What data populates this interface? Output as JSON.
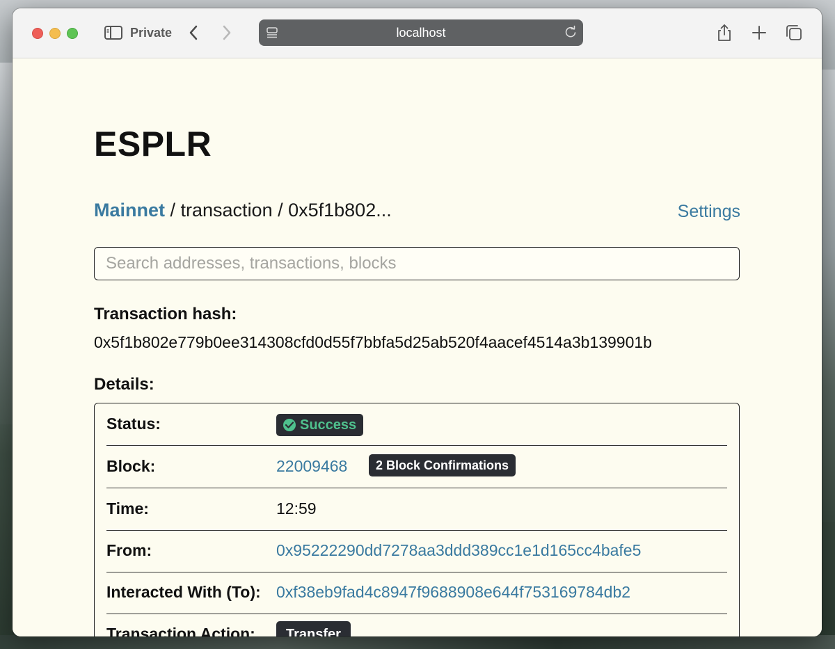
{
  "browser": {
    "mode_label": "Private",
    "url": "localhost"
  },
  "app": {
    "brand": "ESPLR",
    "breadcrumb": {
      "network": "Mainnet",
      "rest": " / transaction / 0x5f1b802..."
    },
    "settings_label": "Settings",
    "search_placeholder": "Search addresses, transactions, blocks"
  },
  "transaction": {
    "hash_heading": "Transaction hash:",
    "hash": "0x5f1b802e779b0ee314308cfd0d55f7bbfa5d25ab520f4aacef4514a3b139901b",
    "details_heading": "Details:",
    "rows": {
      "status": {
        "label": "Status:",
        "value": "Success"
      },
      "block": {
        "label": "Block:",
        "value": "22009468",
        "badge": "2 Block Confirmations"
      },
      "time": {
        "label": "Time:",
        "value": "12:59"
      },
      "from": {
        "label": "From:",
        "value": "0x95222290dd7278aa3ddd389cc1e1d165cc4bafe5"
      },
      "to": {
        "label": "Interacted With (To):",
        "value": "0xf38eb9fad4c8947f9688908e644f753169784db2"
      },
      "action": {
        "label": "Transaction Action:",
        "value": "Transfer"
      }
    }
  },
  "colors": {
    "link": "#3a7aa0",
    "success": "#4fc08d",
    "badge_bg": "#2a2d33",
    "page_bg": "#fdfcf0"
  }
}
